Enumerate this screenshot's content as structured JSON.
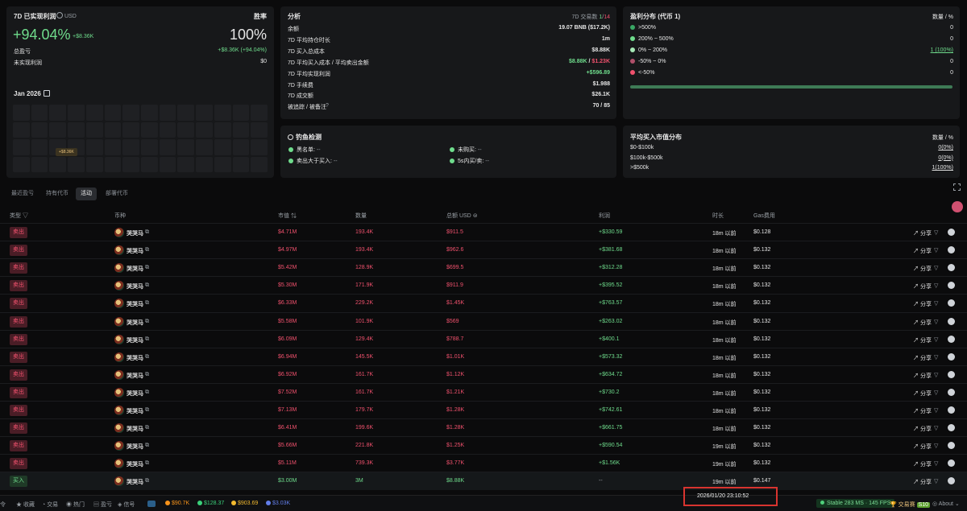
{
  "pnl_card": {
    "title": "7D 已实现利润",
    "currency": "USD",
    "winrate_label": "胜率",
    "pnl_pct": "+94.04%",
    "pnl_usd": "+$8.36K",
    "winrate": "100%",
    "total_label": "总盈亏",
    "total_value": "+$8.36K (+94.04%)",
    "unrealized_label": "未实现利润",
    "unrealized_value": "$0",
    "month": "Jan 2026",
    "cal_tooltip": "+$8.36K"
  },
  "analysis": {
    "title": "分析",
    "trades_label": "7D 交易数",
    "trades_win": "1",
    "trades_sep": "/",
    "trades_total": "14",
    "rows": [
      {
        "label": "余额",
        "value": "19.07 BNB ($17.2K)"
      },
      {
        "label": "7D 平均持仓时长",
        "value": "1m"
      },
      {
        "label": "7D 买入总成本",
        "value": "$8.88K"
      },
      {
        "label": "7D 平均买入成本 / 平均卖出金额",
        "value_a": "$8.88K",
        "value_sep": " / ",
        "value_b": "$1.23K"
      },
      {
        "label": "7D 平均实现利润",
        "value": "+$596.89"
      },
      {
        "label": "7D 手续费",
        "value": "$1.988"
      },
      {
        "label": "7D 成交额",
        "value": "$26.1K"
      },
      {
        "label": "被追踪 / 被备注",
        "value": "70 / 85"
      }
    ]
  },
  "distribution": {
    "title": "盈利分布 (代币 1)",
    "col_label": "数量 / %",
    "rows": [
      {
        "label": ">500%",
        "value": "0",
        "color": "#3aa865"
      },
      {
        "label": "200% ~ 500%",
        "value": "0",
        "color": "#6fdc8c"
      },
      {
        "label": "0% ~ 200%",
        "value": "1 (100%)",
        "color": "#a5e8b5"
      },
      {
        "label": "-50% ~ 0%",
        "value": "0",
        "color": "#b0506a"
      },
      {
        "label": "<-50%",
        "value": "0",
        "color": "#f0516d"
      }
    ]
  },
  "phishing": {
    "title": "钓鱼检测",
    "items": [
      {
        "label": "黑名单:",
        "value": "--"
      },
      {
        "label": "未购买:",
        "value": "--"
      },
      {
        "label": "卖出大于买入:",
        "value": "--"
      },
      {
        "label": "5s内买/卖:",
        "value": "--"
      }
    ]
  },
  "mcap": {
    "title": "平均买入市值分布",
    "col_label": "数量 / %",
    "rows": [
      {
        "label": "$0-$100k",
        "value": "0(0%)"
      },
      {
        "label": "$100k-$500k",
        "value": "0(0%)"
      },
      {
        "label": ">$500k",
        "value": "1(100%)"
      }
    ]
  },
  "tabs": [
    "最近盈亏",
    "持有代币",
    "活动",
    "部署代币"
  ],
  "table": {
    "headers": {
      "type": "类型",
      "token": "币种",
      "mcap": "市值",
      "amount": "数量",
      "total": "总额",
      "total_unit": "USD",
      "profit": "利润",
      "age": "时长",
      "gas": "Gas费用"
    },
    "share_label": "分享",
    "rows": [
      {
        "type": "卖出",
        "token": "哭哭马",
        "mcap": "$4.71M",
        "amount": "193.4K",
        "total": "$911.5",
        "profit": "+$330.59",
        "age": "18m 以前",
        "gas": "$0.128"
      },
      {
        "type": "卖出",
        "token": "哭哭马",
        "mcap": "$4.97M",
        "amount": "193.4K",
        "total": "$962.6",
        "profit": "+$381.68",
        "age": "18m 以前",
        "gas": "$0.132"
      },
      {
        "type": "卖出",
        "token": "哭哭马",
        "mcap": "$5.42M",
        "amount": "128.9K",
        "total": "$699.5",
        "profit": "+$312.28",
        "age": "18m 以前",
        "gas": "$0.132"
      },
      {
        "type": "卖出",
        "token": "哭哭马",
        "mcap": "$5.30M",
        "amount": "171.9K",
        "total": "$911.9",
        "profit": "+$395.52",
        "age": "18m 以前",
        "gas": "$0.132"
      },
      {
        "type": "卖出",
        "token": "哭哭马",
        "mcap": "$6.33M",
        "amount": "229.2K",
        "total": "$1.45K",
        "profit": "+$763.57",
        "age": "18m 以前",
        "gas": "$0.132"
      },
      {
        "type": "卖出",
        "token": "哭哭马",
        "mcap": "$5.58M",
        "amount": "101.9K",
        "total": "$569",
        "profit": "+$263.02",
        "age": "18m 以前",
        "gas": "$0.132"
      },
      {
        "type": "卖出",
        "token": "哭哭马",
        "mcap": "$6.09M",
        "amount": "129.4K",
        "total": "$788.7",
        "profit": "+$400.1",
        "age": "18m 以前",
        "gas": "$0.132"
      },
      {
        "type": "卖出",
        "token": "哭哭马",
        "mcap": "$6.94M",
        "amount": "145.5K",
        "total": "$1.01K",
        "profit": "+$573.32",
        "age": "18m 以前",
        "gas": "$0.132"
      },
      {
        "type": "卖出",
        "token": "哭哭马",
        "mcap": "$6.92M",
        "amount": "161.7K",
        "total": "$1.12K",
        "profit": "+$634.72",
        "age": "18m 以前",
        "gas": "$0.132"
      },
      {
        "type": "卖出",
        "token": "哭哭马",
        "mcap": "$7.52M",
        "amount": "161.7K",
        "total": "$1.21K",
        "profit": "+$730.2",
        "age": "18m 以前",
        "gas": "$0.132"
      },
      {
        "type": "卖出",
        "token": "哭哭马",
        "mcap": "$7.13M",
        "amount": "179.7K",
        "total": "$1.28K",
        "profit": "+$742.61",
        "age": "18m 以前",
        "gas": "$0.132"
      },
      {
        "type": "卖出",
        "token": "哭哭马",
        "mcap": "$6.41M",
        "amount": "199.6K",
        "total": "$1.28K",
        "profit": "+$661.75",
        "age": "18m 以前",
        "gas": "$0.132"
      },
      {
        "type": "卖出",
        "token": "哭哭马",
        "mcap": "$5.66M",
        "amount": "221.8K",
        "total": "$1.25K",
        "profit": "+$590.54",
        "age": "19m 以前",
        "gas": "$0.132"
      },
      {
        "type": "卖出",
        "token": "哭哭马",
        "mcap": "$5.11M",
        "amount": "739.3K",
        "total": "$3.77K",
        "profit": "+$1.56K",
        "age": "19m 以前",
        "gas": "$0.132"
      },
      {
        "type": "买入",
        "token": "哭哭马",
        "mcap": "$3.00M",
        "amount": "3M",
        "total": "$8.88K",
        "profit": "--",
        "age": "19m 以前",
        "gas": "$0.147"
      }
    ]
  },
  "bottom_bar": {
    "items": [
      "收藏",
      "交易",
      "热门",
      "盈亏",
      "信号"
    ],
    "prices": [
      {
        "value": "$90.7K",
        "color": "#f7931a"
      },
      {
        "value": "$128.37",
        "color": "#3ad07a"
      },
      {
        "value": "$903.69",
        "color": "#f3ba2f"
      },
      {
        "value": "$3.03K",
        "color": "#627eea"
      }
    ],
    "timestamp": "2026/01/20 23:10:52",
    "status": "Stable 283 MS · 145 FPS",
    "tournament": "交易赛",
    "tournament_badge": "S10",
    "about": "About"
  }
}
